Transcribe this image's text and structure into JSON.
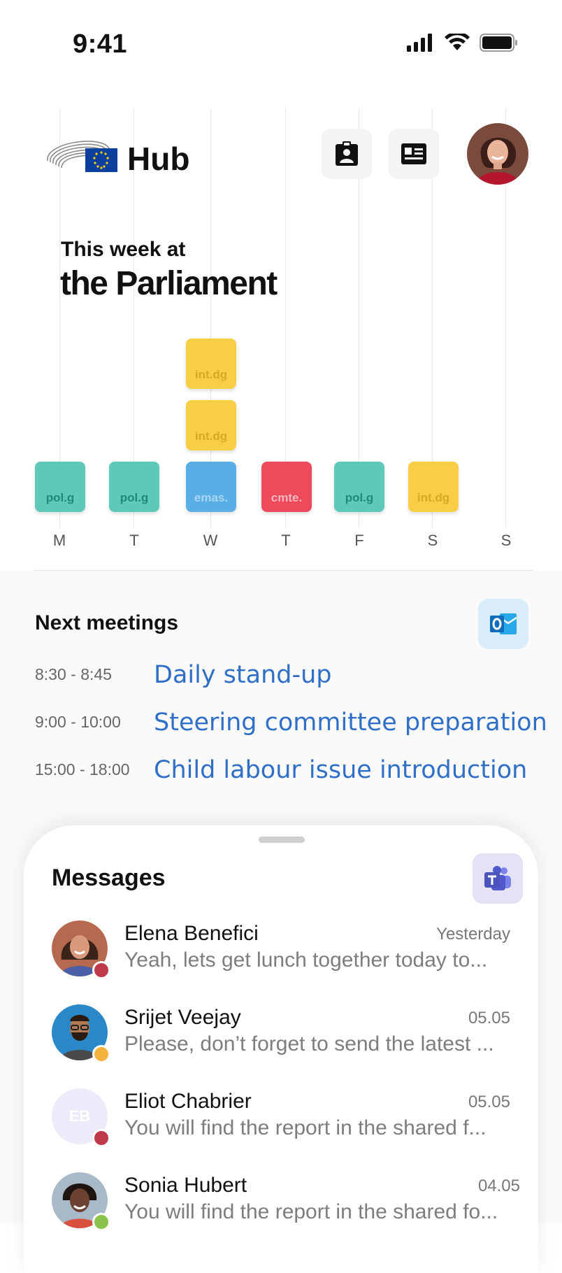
{
  "status_bar": {
    "time": "9:41"
  },
  "header": {
    "brand": "Hub"
  },
  "hero": {
    "line1": "This week at",
    "line2": "the Parliament"
  },
  "week": {
    "days": [
      "M",
      "T",
      "W",
      "T",
      "F",
      "S",
      "S"
    ],
    "blocks": {
      "mon": "pol.g",
      "tue": "pol.g",
      "wed_1": "emas.",
      "wed_2": "int.dg",
      "wed_3": "int.dg",
      "thu": "cmte.",
      "fri": "pol.g",
      "sat": "int.dg"
    }
  },
  "meetings": {
    "title": "Next meetings",
    "items": [
      {
        "time": "8:30 - 8:45",
        "title": "Daily stand-up"
      },
      {
        "time": "9:00 - 10:00",
        "title": "Steering committee preparation"
      },
      {
        "time": "15:00 - 18:00",
        "title": "Child labour issue introduction"
      }
    ]
  },
  "messages": {
    "title": "Messages",
    "items": [
      {
        "name": "Elena Benefici",
        "time": "Yesterday",
        "preview": "Yeah, lets get lunch together today to...",
        "status_color": "#c0394b"
      },
      {
        "name": "Srijet Veejay",
        "time": "05.05",
        "preview": "Please, don’t forget to send the latest ...",
        "status_color": "#f4b33a"
      },
      {
        "name": "Eliot Chabrier",
        "time": "05.05",
        "preview": "You will find the report in the shared f...",
        "status_color": "#c0394b",
        "initials": "EB"
      },
      {
        "name": "Sonia Hubert",
        "time": "04.05",
        "preview": "You will find the report in the shared fo...",
        "status_color": "#8bc34a"
      }
    ]
  },
  "colors": {
    "accent_link": "#2f6fc7",
    "teal": "#5ec8bb",
    "yellow": "#f7ce46",
    "blue": "#5aaee6",
    "red": "#ee4a5c"
  }
}
